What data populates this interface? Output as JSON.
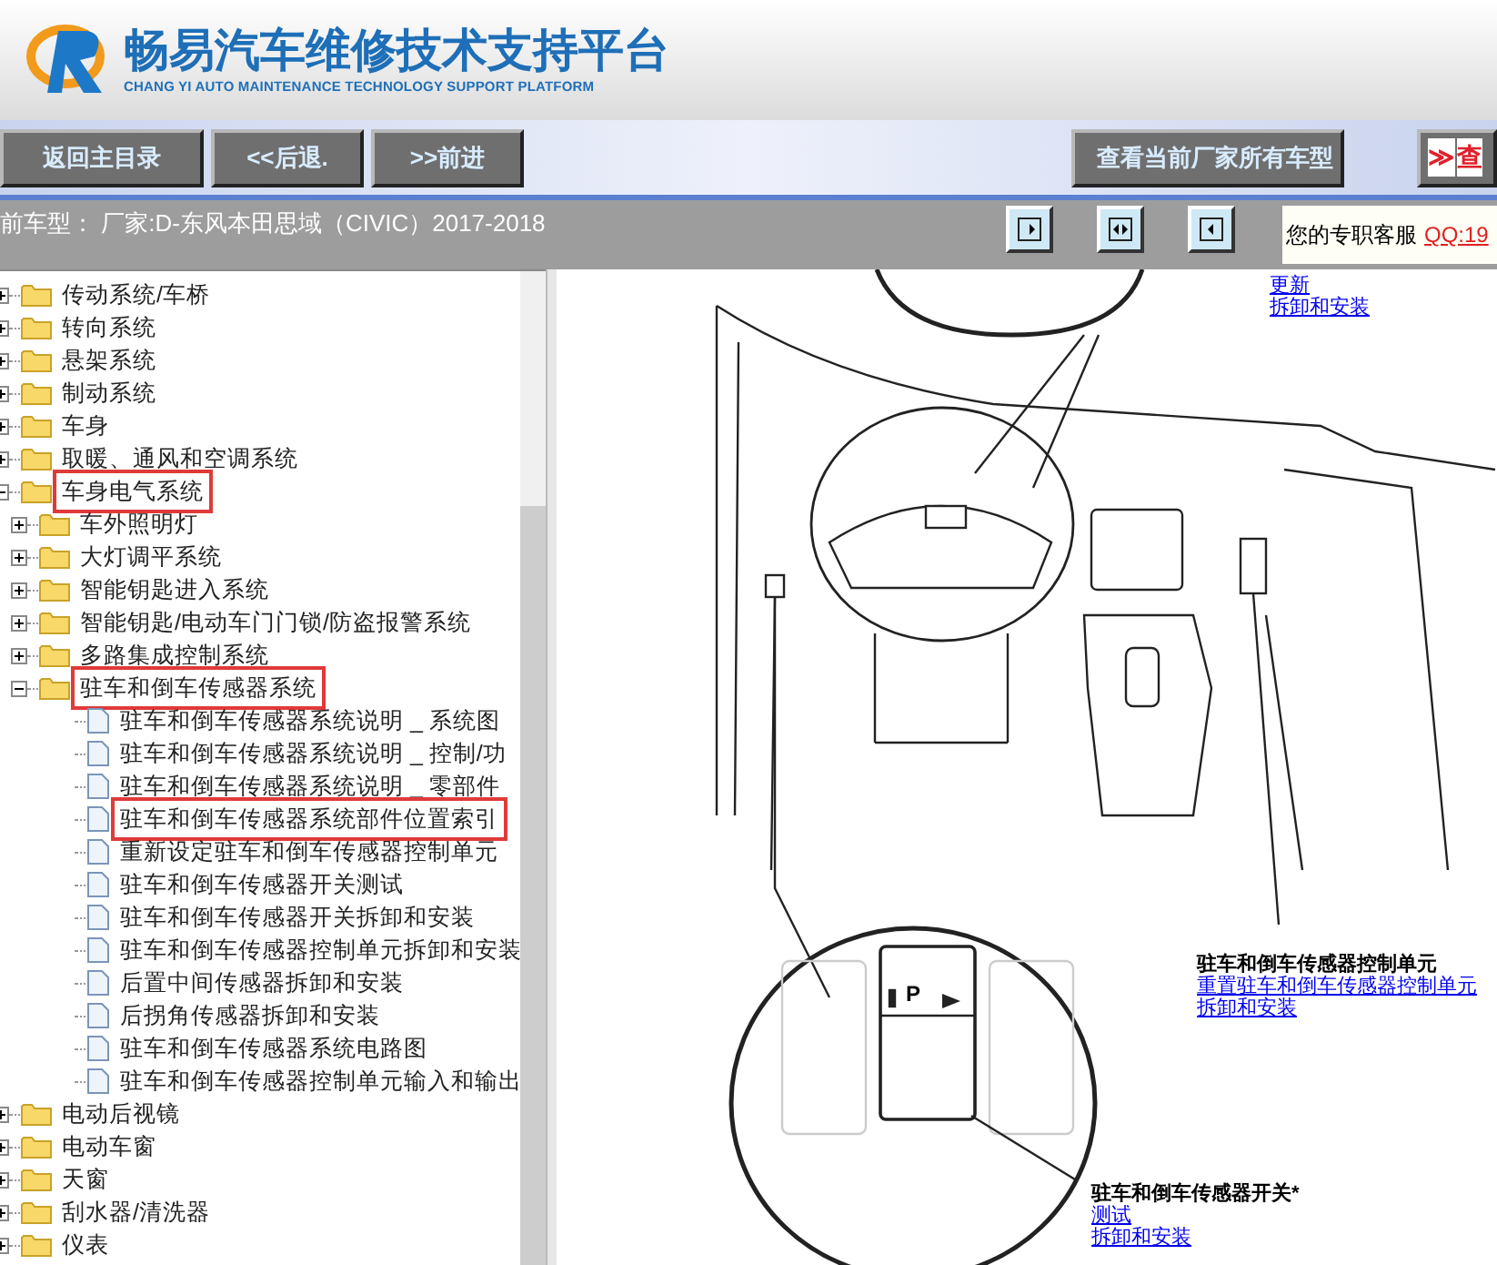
{
  "header": {
    "title": "畅易汽车维修技术支持平台",
    "subtitle": "CHANG YI AUTO MAINTENANCE TECHNOLOGY SUPPORT PLATFORM"
  },
  "nav": {
    "buttons": [
      "返回主目录",
      "<<后退.",
      ">>前进"
    ],
    "right_button": "查看当前厂家所有车型",
    "cut_button": {
      "arrows": "≫",
      "label": "查"
    }
  },
  "info_bar": {
    "vehicle": "前车型： 厂家:D-东风本田思域（CIVIC）2017-2018",
    "service_label": "您的专职客服",
    "service_link": "QQ:19"
  },
  "tree": [
    {
      "label": "传动系统/车桥",
      "kind": "folder",
      "expanded": false,
      "marked": false
    },
    {
      "label": "转向系统",
      "kind": "folder",
      "expanded": false,
      "marked": false
    },
    {
      "label": "悬架系统",
      "kind": "folder",
      "expanded": false,
      "marked": false
    },
    {
      "label": "制动系统",
      "kind": "folder",
      "expanded": false,
      "marked": false
    },
    {
      "label": "车身",
      "kind": "folder",
      "expanded": false,
      "marked": false
    },
    {
      "label": "取暖、通风和空调系统",
      "kind": "folder",
      "expanded": false,
      "marked": false
    },
    {
      "label": "车身电气系统",
      "kind": "folder",
      "expanded": true,
      "marked": true,
      "children": [
        {
          "label": "车外照明灯",
          "kind": "folder",
          "expanded": false,
          "marked": false
        },
        {
          "label": "大灯调平系统",
          "kind": "folder",
          "expanded": false,
          "marked": false
        },
        {
          "label": "智能钥匙进入系统",
          "kind": "folder",
          "expanded": false,
          "marked": false
        },
        {
          "label": "智能钥匙/电动车门门锁/防盗报警系统",
          "kind": "folder",
          "expanded": false,
          "marked": false
        },
        {
          "label": "多路集成控制系统",
          "kind": "folder",
          "expanded": false,
          "marked": false
        },
        {
          "label": "驻车和倒车传感器系统",
          "kind": "folder",
          "expanded": true,
          "marked": true,
          "children": [
            {
              "label": "驻车和倒车传感器系统说明 _ 系统图",
              "kind": "page",
              "marked": false
            },
            {
              "label": "驻车和倒车传感器系统说明 _ 控制/功",
              "kind": "page",
              "marked": false
            },
            {
              "label": "驻车和倒车传感器系统说明 _ 零部件",
              "kind": "page",
              "marked": false
            },
            {
              "label": "驻车和倒车传感器系统部件位置索引",
              "kind": "page",
              "marked": true
            },
            {
              "label": "重新设定驻车和倒车传感器控制单元",
              "kind": "page",
              "marked": false
            },
            {
              "label": "驻车和倒车传感器开关测试",
              "kind": "page",
              "marked": false
            },
            {
              "label": "驻车和倒车传感器开关拆卸和安装",
              "kind": "page",
              "marked": false
            },
            {
              "label": "驻车和倒车传感器控制单元拆卸和安装",
              "kind": "page",
              "marked": false
            },
            {
              "label": "后置中间传感器拆卸和安装",
              "kind": "page",
              "marked": false
            },
            {
              "label": "后拐角传感器拆卸和安装",
              "kind": "page",
              "marked": false
            },
            {
              "label": "驻车和倒车传感器系统电路图",
              "kind": "page",
              "marked": false
            },
            {
              "label": "驻车和倒车传感器控制单元输入和输出",
              "kind": "page",
              "marked": false
            }
          ]
        }
      ]
    },
    {
      "label": "电动后视镜",
      "kind": "folder",
      "expanded": false,
      "marked": false
    },
    {
      "label": "电动车窗",
      "kind": "folder",
      "expanded": false,
      "marked": false
    },
    {
      "label": "天窗",
      "kind": "folder",
      "expanded": false,
      "marked": false
    },
    {
      "label": "刮水器/清洗器",
      "kind": "folder",
      "expanded": false,
      "marked": false
    },
    {
      "label": "仪表",
      "kind": "folder",
      "expanded": false,
      "marked": false
    }
  ],
  "diagram": {
    "switch_label": "P",
    "callouts": [
      {
        "links": [
          "更新",
          "拆卸和安装"
        ]
      },
      {
        "title": "驻车和倒车传感器控制单元",
        "links": [
          "重置驻车和倒车传感器控制单元",
          "拆卸和安装"
        ]
      },
      {
        "title": "驻车和倒车传感器开关*",
        "links": [
          "测试",
          "拆卸和安装"
        ]
      }
    ]
  }
}
